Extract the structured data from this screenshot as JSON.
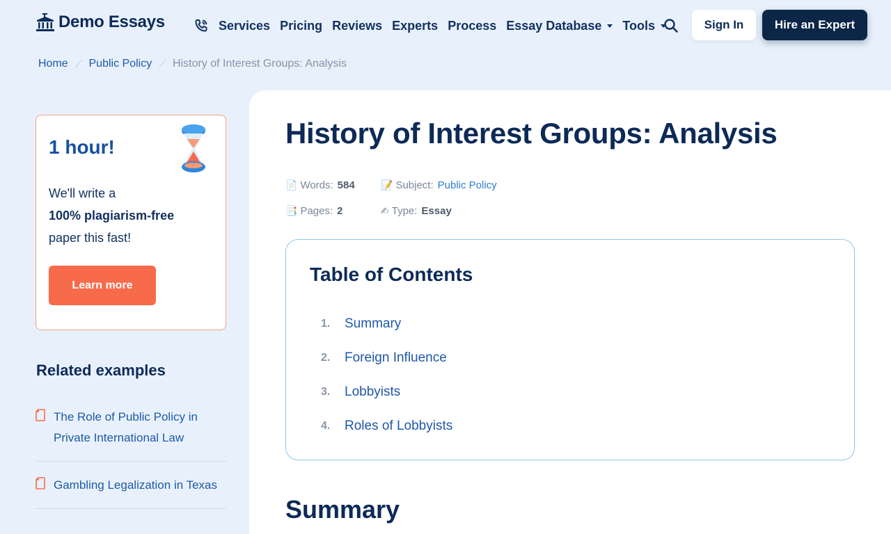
{
  "header": {
    "logo_text": "Demo Essays",
    "nav": [
      {
        "label": "Services"
      },
      {
        "label": "Pricing"
      },
      {
        "label": "Reviews"
      },
      {
        "label": "Experts"
      },
      {
        "label": "Process"
      },
      {
        "label": "Essay Database"
      },
      {
        "label": "Tools"
      }
    ],
    "signin_label": "Sign In",
    "hire_label": "Hire an Expert"
  },
  "breadcrumb": {
    "home": "Home",
    "category": "Public Policy",
    "current": "History of Interest Groups: Analysis",
    "separator": "⟋"
  },
  "promo": {
    "title": "1 hour!",
    "line1": "We'll write a",
    "line2_bold": "100% plagiarism-free",
    "line3": "paper this fast!",
    "button_label": "Learn more"
  },
  "related": {
    "title": "Related examples",
    "items": [
      {
        "label": "The Role of Public Policy in Private International Law"
      },
      {
        "label": "Gambling Legalization in Texas"
      }
    ]
  },
  "article": {
    "title": "History of Interest Groups: Analysis",
    "meta": {
      "words_label": "Words:",
      "words_value": "584",
      "subject_label": "Subject:",
      "subject_value": "Public Policy",
      "pages_label": "Pages:",
      "pages_value": "2",
      "type_label": "Type:",
      "type_value": "Essay"
    },
    "toc": {
      "title": "Table of Contents",
      "items": [
        {
          "num": "1.",
          "label": "Summary"
        },
        {
          "num": "2.",
          "label": "Foreign Influence"
        },
        {
          "num": "3.",
          "label": "Lobbyists"
        },
        {
          "num": "4.",
          "label": "Roles of Lobbyists"
        }
      ]
    },
    "first_section_heading": "Summary"
  },
  "colors": {
    "page_bg": "#e8f1fb",
    "navy": "#0d2a57",
    "link_blue": "#1e58a8",
    "accent_orange": "#f76b4b",
    "hire_button": "#0c2647"
  },
  "icons": {
    "logo": "institution-icon",
    "phone": "phone-icon",
    "search": "search-icon",
    "hourglass": "hourglass-icon",
    "document": "document-icon",
    "words": "page-icon",
    "subject": "memo-icon",
    "pages": "bookmark-tabs-icon",
    "type": "writing-hand-icon"
  }
}
